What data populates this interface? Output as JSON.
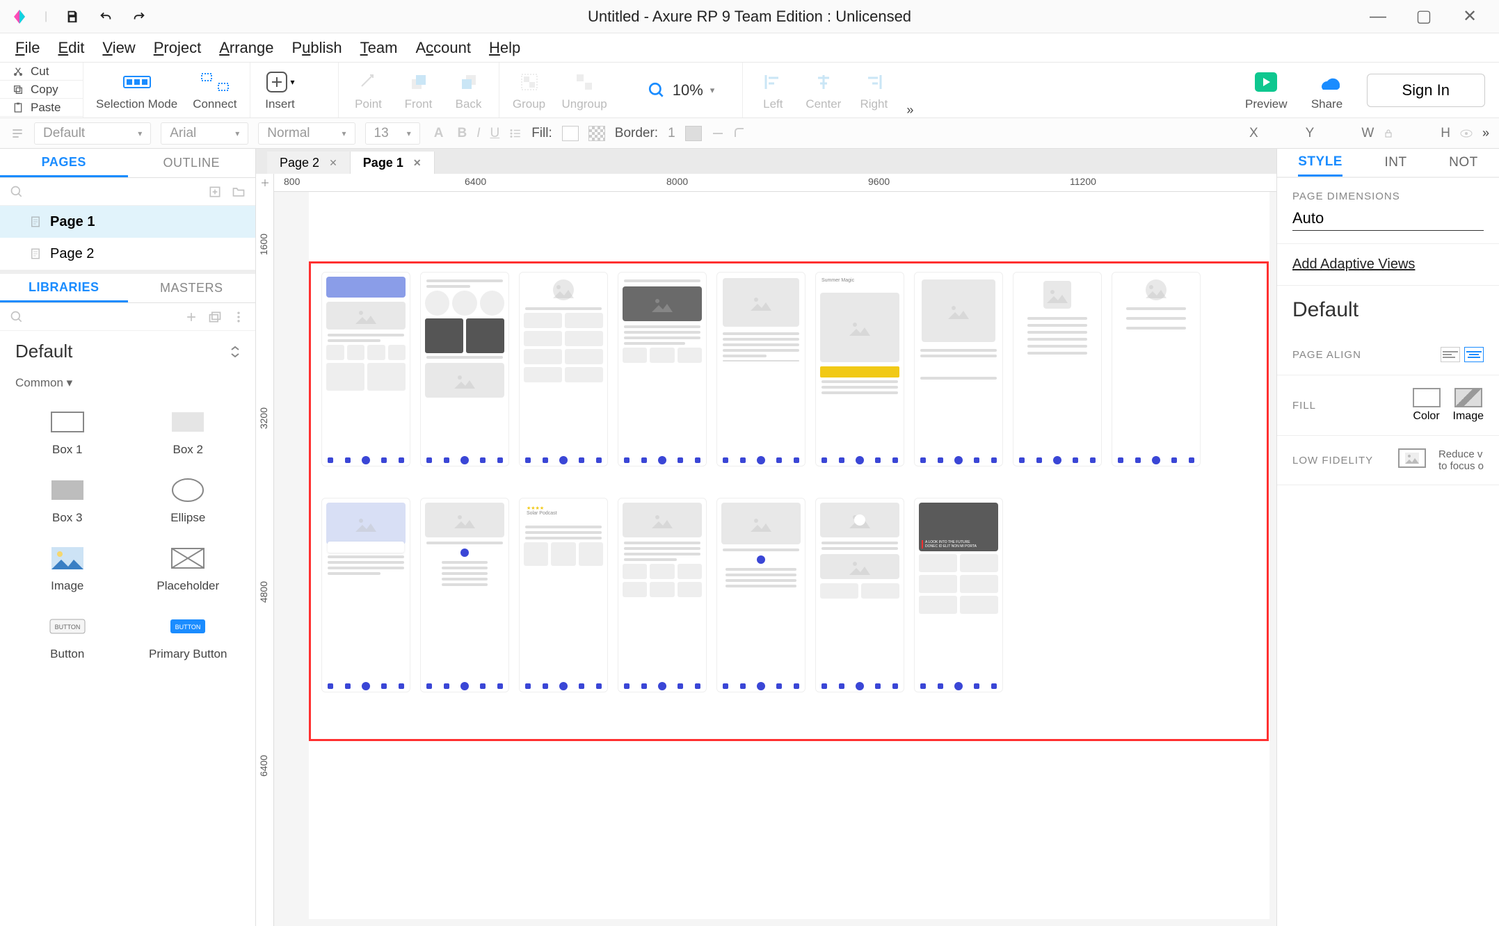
{
  "title": "Untitled - Axure RP 9 Team Edition : Unlicensed",
  "menus": [
    "File",
    "Edit",
    "View",
    "Project",
    "Arrange",
    "Publish",
    "Team",
    "Account",
    "Help"
  ],
  "clipboard": {
    "cut": "Cut",
    "copy": "Copy",
    "paste": "Paste"
  },
  "toolbar": {
    "selection_mode": "Selection Mode",
    "connect": "Connect",
    "insert": "Insert",
    "point": "Point",
    "front": "Front",
    "back": "Back",
    "group": "Group",
    "ungroup": "Ungroup",
    "left": "Left",
    "center": "Center",
    "right": "Right",
    "preview": "Preview",
    "share": "Share",
    "signin": "Sign In",
    "zoom_value": "10%"
  },
  "stylebar": {
    "style": "Default",
    "font": "Arial",
    "weight": "Normal",
    "size": "13",
    "fill_label": "Fill:",
    "border_label": "Border:",
    "border_val": "1",
    "x": "X",
    "y": "Y",
    "w": "W",
    "h": "H"
  },
  "pages_panel": {
    "tab_pages": "PAGES",
    "tab_outline": "OUTLINE",
    "items": [
      {
        "name": "Page 1",
        "selected": true
      },
      {
        "name": "Page 2",
        "selected": false
      }
    ]
  },
  "libraries_panel": {
    "tab_libraries": "LIBRARIES",
    "tab_masters": "MASTERS",
    "current": "Default",
    "section": "Common ▾",
    "shapes": [
      {
        "label": "Box 1",
        "type": "box1"
      },
      {
        "label": "Box 2",
        "type": "box2"
      },
      {
        "label": "Box 3",
        "type": "box3"
      },
      {
        "label": "Ellipse",
        "type": "ellipse"
      },
      {
        "label": "Image",
        "type": "image"
      },
      {
        "label": "Placeholder",
        "type": "placeholder"
      },
      {
        "label": "Button",
        "type": "button"
      },
      {
        "label": "Primary Button",
        "type": "primary-button"
      }
    ]
  },
  "doc_tabs": [
    {
      "name": "Page 2",
      "active": false
    },
    {
      "name": "Page 1",
      "active": true
    }
  ],
  "ruler_h": [
    "800",
    "6400",
    "8000",
    "9600",
    "11200"
  ],
  "ruler_v": [
    "1600",
    "3200",
    "4800",
    "6400"
  ],
  "right_panel": {
    "tabs": [
      "STYLE",
      "INT",
      "NOT"
    ],
    "dimensions_label": "PAGE DIMENSIONS",
    "dimensions_value": "Auto",
    "adaptive": "Add Adaptive Views",
    "default_heading": "Default",
    "align_label": "PAGE ALIGN",
    "fill_label": "FILL",
    "fill_color": "Color",
    "fill_image": "Image",
    "low_fidelity": "LOW FIDELITY",
    "low_fidelity_desc": "Reduce v\nto focus o"
  },
  "wireframes_row1": 9,
  "wireframes_row2": 7
}
